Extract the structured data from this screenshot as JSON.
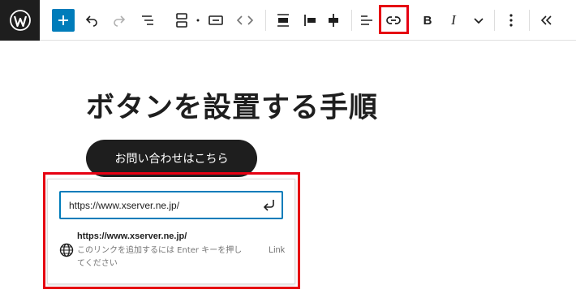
{
  "toolbar": {
    "items": [
      {
        "name": "wordpress-logo-icon"
      },
      {
        "name": "plus-icon"
      },
      {
        "name": "undo-icon"
      },
      {
        "name": "redo-icon"
      },
      {
        "name": "list-view-icon"
      },
      {
        "name": "button-block-icon"
      },
      {
        "name": "button-variation-icon"
      },
      {
        "name": "code-chevrons-icon"
      },
      {
        "name": "align-full-icon"
      },
      {
        "name": "align-left-icon"
      },
      {
        "name": "align-center-icon"
      },
      {
        "name": "justify-icon"
      },
      {
        "name": "link-icon",
        "highlighted": true
      },
      {
        "name": "bold-icon"
      },
      {
        "name": "italic-icon"
      },
      {
        "name": "chevron-down-icon"
      },
      {
        "name": "more-options-icon"
      },
      {
        "name": "collapse-icon"
      }
    ],
    "bold_label": "B",
    "italic_label": "I",
    "accent_color": "#007cba",
    "highlight_color": "#e60012"
  },
  "content": {
    "title": "ボタンを設置する手順",
    "button_label": "お問い合わせはこちら"
  },
  "link_popover": {
    "url_value": "https://www.xserver.ne.jp/",
    "suggestion_url": "https://www.xserver.ne.jp/",
    "suggestion_description": "このリンクを追加するには Enter キーを押してください",
    "suggestion_type": "Link"
  }
}
